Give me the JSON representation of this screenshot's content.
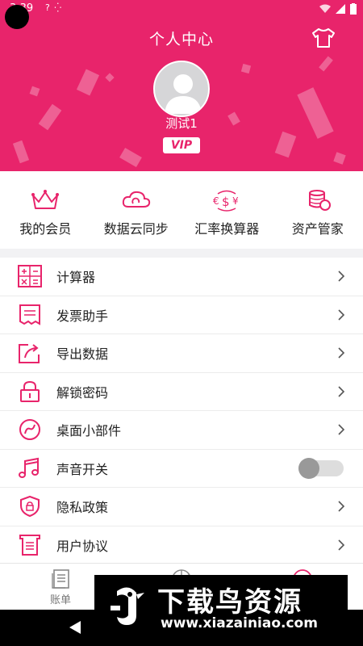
{
  "status_bar": {
    "time": "3:39",
    "signal_text": "? ⁛"
  },
  "header": {
    "title": "个人中心",
    "username": "测试1",
    "vip_label": "VIP"
  },
  "quick_actions": [
    {
      "label": "我的会员",
      "icon": "crown-icon"
    },
    {
      "label": "数据云同步",
      "icon": "cloud-sync-icon"
    },
    {
      "label": "汇率换算器",
      "icon": "currency-exchange-icon"
    },
    {
      "label": "资产管家",
      "icon": "coins-icon"
    }
  ],
  "menu": [
    {
      "label": "计算器",
      "icon": "calculator-icon",
      "type": "link"
    },
    {
      "label": "发票助手",
      "icon": "receipt-icon",
      "type": "link"
    },
    {
      "label": "导出数据",
      "icon": "export-icon",
      "type": "link"
    },
    {
      "label": "解锁密码",
      "icon": "lock-icon",
      "type": "link"
    },
    {
      "label": "桌面小部件",
      "icon": "widget-icon",
      "type": "link"
    },
    {
      "label": "声音开关",
      "icon": "music-note-icon",
      "type": "toggle",
      "on": false
    },
    {
      "label": "隐私政策",
      "icon": "shield-icon",
      "type": "link"
    },
    {
      "label": "用户协议",
      "icon": "agreement-icon",
      "type": "link"
    }
  ],
  "tabbar": {
    "bill_label": "账单"
  },
  "watermark": {
    "brand": "下载鸟资源",
    "url": "www.xiazainiao.com"
  },
  "colors": {
    "accent": "#e8246b",
    "background": "#f2f2f4"
  }
}
